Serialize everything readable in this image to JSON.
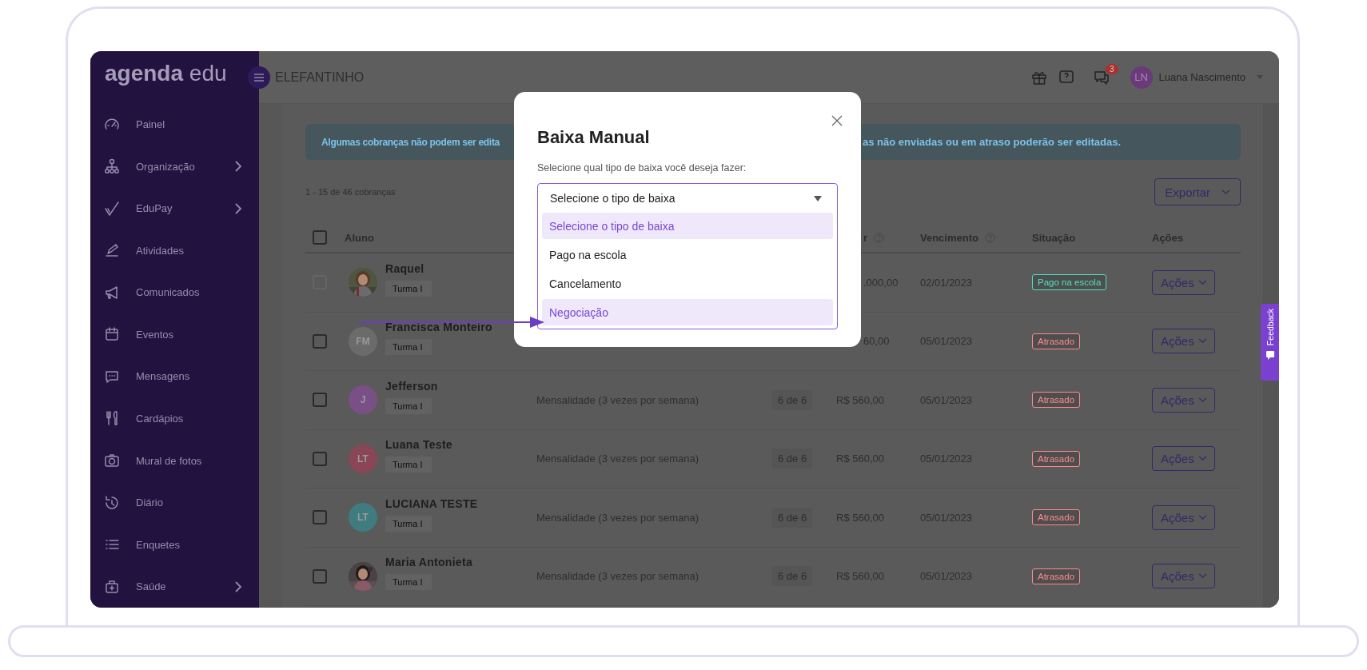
{
  "brand": {
    "logo": "**agenda** edu"
  },
  "sidebar": {
    "items": [
      {
        "label": "Painel",
        "has_submenu": false
      },
      {
        "label": "Organização",
        "has_submenu": true
      },
      {
        "label": "EduPay",
        "has_submenu": true
      },
      {
        "label": "Atividades",
        "has_submenu": false
      },
      {
        "label": "Comunicados",
        "has_submenu": false
      },
      {
        "label": "Eventos",
        "has_submenu": false
      },
      {
        "label": "Mensagens",
        "has_submenu": false
      },
      {
        "label": "Cardápios",
        "has_submenu": false
      },
      {
        "label": "Mural de fotos",
        "has_submenu": false
      },
      {
        "label": "Diário",
        "has_submenu": false
      },
      {
        "label": "Enquetes",
        "has_submenu": false
      },
      {
        "label": "Saúde",
        "has_submenu": true
      }
    ]
  },
  "topbar": {
    "school": "ELEFANTINHO",
    "messages_badge": "3",
    "user": {
      "initials": "LN",
      "name": "Luana Nascimento"
    }
  },
  "alert": {
    "text_left": "Algumas cobranças não podem ser edita",
    "text_right": "as não enviadas ou em atraso poderão ser editadas."
  },
  "summary": "1 - 15 de 46 cobranças",
  "export_button": "Exportar",
  "table": {
    "select_all_checked": false,
    "columns": [
      {
        "label": "Aluno",
        "help": false
      },
      {
        "label": "r",
        "help": true
      },
      {
        "label": "Vencimento",
        "help": true
      },
      {
        "label": "Situação",
        "help": false
      },
      {
        "label": "Ações",
        "help": false
      }
    ],
    "rows": [
      {
        "covered": true,
        "checked": false,
        "disabled": true,
        "name": "Raquel",
        "group": "Turma I",
        "value": ".000,00",
        "due": "02/01/2023",
        "status": {
          "label": "Pago na escola",
          "kind": "paid"
        },
        "action": "Ações"
      },
      {
        "covered": true,
        "checked": false,
        "disabled": false,
        "name": "Francisca Monteiro",
        "group": "Turma I",
        "avatar": {
          "kind": "initials",
          "initials": "FM",
          "color": "#6b6b6b"
        },
        "value": "60,00",
        "due": "05/01/2023",
        "status": {
          "label": "Atrasado",
          "kind": "overdue"
        },
        "action": "Ações"
      },
      {
        "covered": false,
        "checked": false,
        "disabled": false,
        "name": "Jefferson",
        "group": "Turma I",
        "avatar": {
          "kind": "initials",
          "initials": "J",
          "color": "#7a4f86"
        },
        "description": "Mensalidade (3 vezes por semana)",
        "installment": "6 de 6",
        "value": "R$ 560,00",
        "due": "05/01/2023",
        "status": {
          "label": "Atrasado",
          "kind": "overdue"
        },
        "action": "Ações"
      },
      {
        "covered": false,
        "checked": false,
        "disabled": false,
        "name": "Luana Teste",
        "group": "Turma I",
        "avatar": {
          "kind": "initials",
          "initials": "LT",
          "color": "#8a4656"
        },
        "description": "Mensalidade (3 vezes por semana)",
        "installment": "6 de 6",
        "value": "R$ 560,00",
        "due": "05/01/2023",
        "status": {
          "label": "Atrasado",
          "kind": "overdue"
        },
        "action": "Ações"
      },
      {
        "covered": false,
        "checked": false,
        "disabled": false,
        "name": "LUCIANA TESTE",
        "group": "Turma I",
        "avatar": {
          "kind": "initials",
          "initials": "LT",
          "color": "#3e7c80"
        },
        "description": "Mensalidade (3 vezes por semana)",
        "installment": "6 de 6",
        "value": "R$ 560,00",
        "due": "05/01/2023",
        "status": {
          "label": "Atrasado",
          "kind": "overdue"
        },
        "action": "Ações"
      },
      {
        "covered": false,
        "checked": false,
        "disabled": false,
        "name": "Maria Antonieta",
        "group": "Turma I",
        "description": "Mensalidade (3 vezes por semana)",
        "installment": "6 de 6",
        "value": "R$ 560,00",
        "due": "05/01/2023",
        "status": {
          "label": "Atrasado",
          "kind": "overdue"
        },
        "action": "Ações"
      }
    ]
  },
  "dialog": {
    "title": "Baixa Manual",
    "prompt": "Selecione qual tipo de baixa você deseja fazer:",
    "select": {
      "value": "Selecione o tipo de baixa",
      "options": [
        {
          "label": "Selecione o tipo de baixa",
          "highlighted": true
        },
        {
          "label": "Pago na escola",
          "highlighted": false
        },
        {
          "label": "Cancelamento",
          "highlighted": false
        },
        {
          "label": "Negociação",
          "highlighted": true
        }
      ]
    }
  },
  "feedback_tab": {
    "label": "Feedback"
  }
}
